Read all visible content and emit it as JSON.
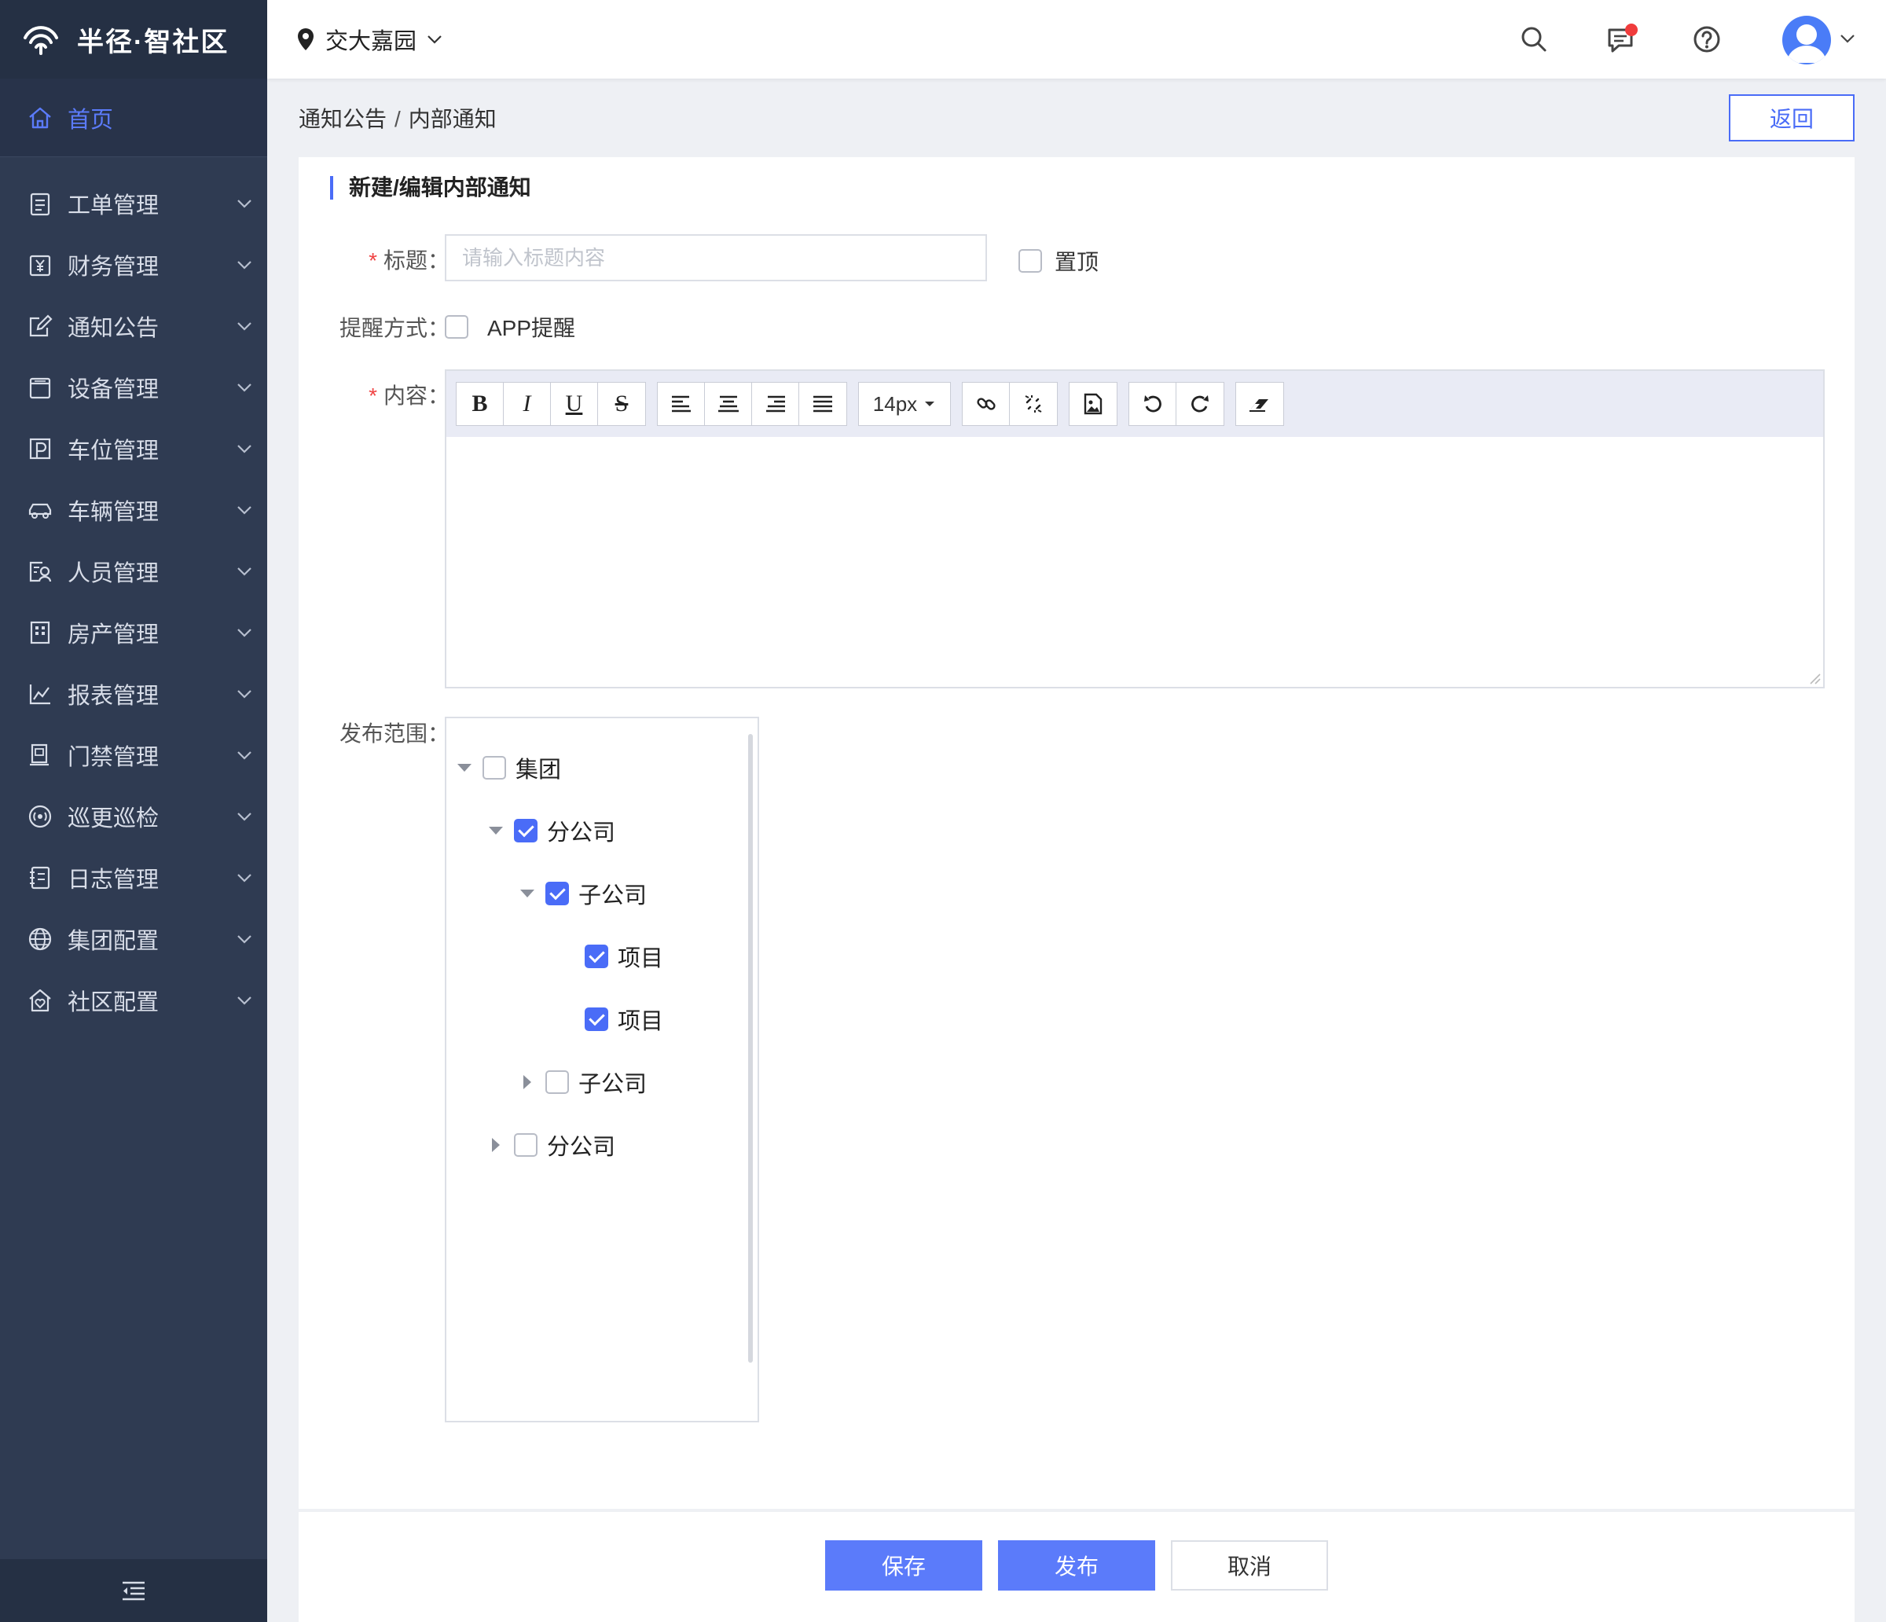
{
  "brand": {
    "name": "半径·智社区"
  },
  "sidebar": {
    "home": {
      "label": "首页",
      "icon": "home-icon"
    },
    "items": [
      {
        "label": "工单管理",
        "icon": "clipboard-icon"
      },
      {
        "label": "财务管理",
        "icon": "finance-icon"
      },
      {
        "label": "通知公告",
        "icon": "edit-note-icon"
      },
      {
        "label": "设备管理",
        "icon": "device-icon"
      },
      {
        "label": "车位管理",
        "icon": "parking-icon"
      },
      {
        "label": "车辆管理",
        "icon": "car-icon"
      },
      {
        "label": "人员管理",
        "icon": "person-card-icon"
      },
      {
        "label": "房产管理",
        "icon": "building-icon"
      },
      {
        "label": "报表管理",
        "icon": "chart-icon"
      },
      {
        "label": "门禁管理",
        "icon": "door-icon"
      },
      {
        "label": "巡更巡检",
        "icon": "patrol-icon"
      },
      {
        "label": "日志管理",
        "icon": "log-icon"
      },
      {
        "label": "集团配置",
        "icon": "globe-icon"
      },
      {
        "label": "社区配置",
        "icon": "community-icon"
      }
    ],
    "collapse_icon": "menu-collapse-icon"
  },
  "topbar": {
    "location": "交大嘉园",
    "icons": [
      "search-icon",
      "message-icon",
      "help-icon",
      "avatar"
    ]
  },
  "breadcrumb": {
    "parent": "通知公告",
    "separator": "/",
    "current": "内部通知"
  },
  "back_label": "返回",
  "form": {
    "title": "新建/编辑内部通知",
    "title_label": "标题：",
    "title_placeholder": "请输入标题内容",
    "title_value": "",
    "pin_label": "置顶",
    "pin_checked": false,
    "remind_label": "提醒方式：",
    "remind_option": "APP提醒",
    "remind_checked": false,
    "content_label": "内容：",
    "font_size": "14px",
    "scope_label": "发布范围：",
    "required_mark": "*"
  },
  "editor_toolbar": {
    "bold": "B",
    "italic": "I",
    "underline": "U",
    "strike": "S"
  },
  "tree": [
    {
      "label": "集团",
      "level": 0,
      "expanded": true,
      "checked": false
    },
    {
      "label": "分公司",
      "level": 1,
      "expanded": true,
      "checked": true
    },
    {
      "label": "子公司",
      "level": 2,
      "expanded": true,
      "checked": true
    },
    {
      "label": "项目",
      "level": 3,
      "leaf": true,
      "checked": true
    },
    {
      "label": "项目",
      "level": 3,
      "leaf": true,
      "checked": true
    },
    {
      "label": "子公司",
      "level": 2,
      "expanded": false,
      "checked": false
    },
    {
      "label": "分公司",
      "level": 1,
      "expanded": false,
      "checked": false
    }
  ],
  "footer": {
    "save": "保存",
    "publish": "发布",
    "cancel": "取消"
  },
  "colors": {
    "primary": "#5b7bfa",
    "sidebar": "#2f3b52",
    "required": "#f04545"
  }
}
